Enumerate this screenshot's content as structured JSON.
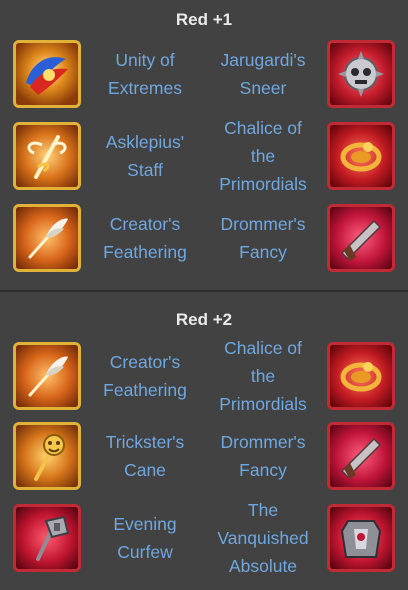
{
  "sections": [
    {
      "title": "Red +1",
      "rows": [
        {
          "left": {
            "lines": [
              "Unity of",
              "Extremes"
            ],
            "icon": "unity-of-extremes-icon",
            "frame": "gold"
          },
          "right": {
            "lines": [
              "Jarugardi's",
              "Sneer"
            ],
            "icon": "jarugardis-sneer-icon",
            "frame": "red"
          }
        },
        {
          "left": {
            "lines": [
              "Asklepius'",
              "Staff"
            ],
            "icon": "asklepius-staff-icon",
            "frame": "gold"
          },
          "right": {
            "lines": [
              "Chalice of",
              "the",
              "Primordials"
            ],
            "icon": "chalice-of-the-primordials-icon",
            "frame": "red"
          }
        },
        {
          "left": {
            "lines": [
              "Creator's",
              "Feathering"
            ],
            "icon": "creators-feathering-icon",
            "frame": "gold"
          },
          "right": {
            "lines": [
              "Drommer's",
              "Fancy"
            ],
            "icon": "drommers-fancy-icon",
            "frame": "red"
          }
        }
      ]
    },
    {
      "title": "Red +2",
      "rows": [
        {
          "left": {
            "lines": [
              "Creator's",
              "Feathering"
            ],
            "icon": "creators-feathering-icon",
            "frame": "gold"
          },
          "right": {
            "lines": [
              "Chalice of",
              "the",
              "Primordials"
            ],
            "icon": "chalice-of-the-primordials-icon",
            "frame": "red"
          }
        },
        {
          "left": {
            "lines": [
              "Trickster's",
              "Cane"
            ],
            "icon": "tricksters-cane-icon",
            "frame": "gold"
          },
          "right": {
            "lines": [
              "Drommer's",
              "Fancy"
            ],
            "icon": "drommers-fancy-icon",
            "frame": "red"
          }
        },
        {
          "left": {
            "lines": [
              "Evening",
              "Curfew"
            ],
            "icon": "evening-curfew-icon",
            "frame": "red"
          },
          "right": {
            "lines": [
              "The",
              "Vanquished",
              "Absolute"
            ],
            "icon": "the-vanquished-absolute-icon",
            "frame": "red"
          }
        }
      ]
    }
  ],
  "colors": {
    "background": "#424242",
    "divider": "#2f2f2f",
    "heading_text": "#eaeaea",
    "item_name_text": "#6fa7e0",
    "gold_frame": "#e1b23a",
    "red_frame": "#c22a35"
  }
}
